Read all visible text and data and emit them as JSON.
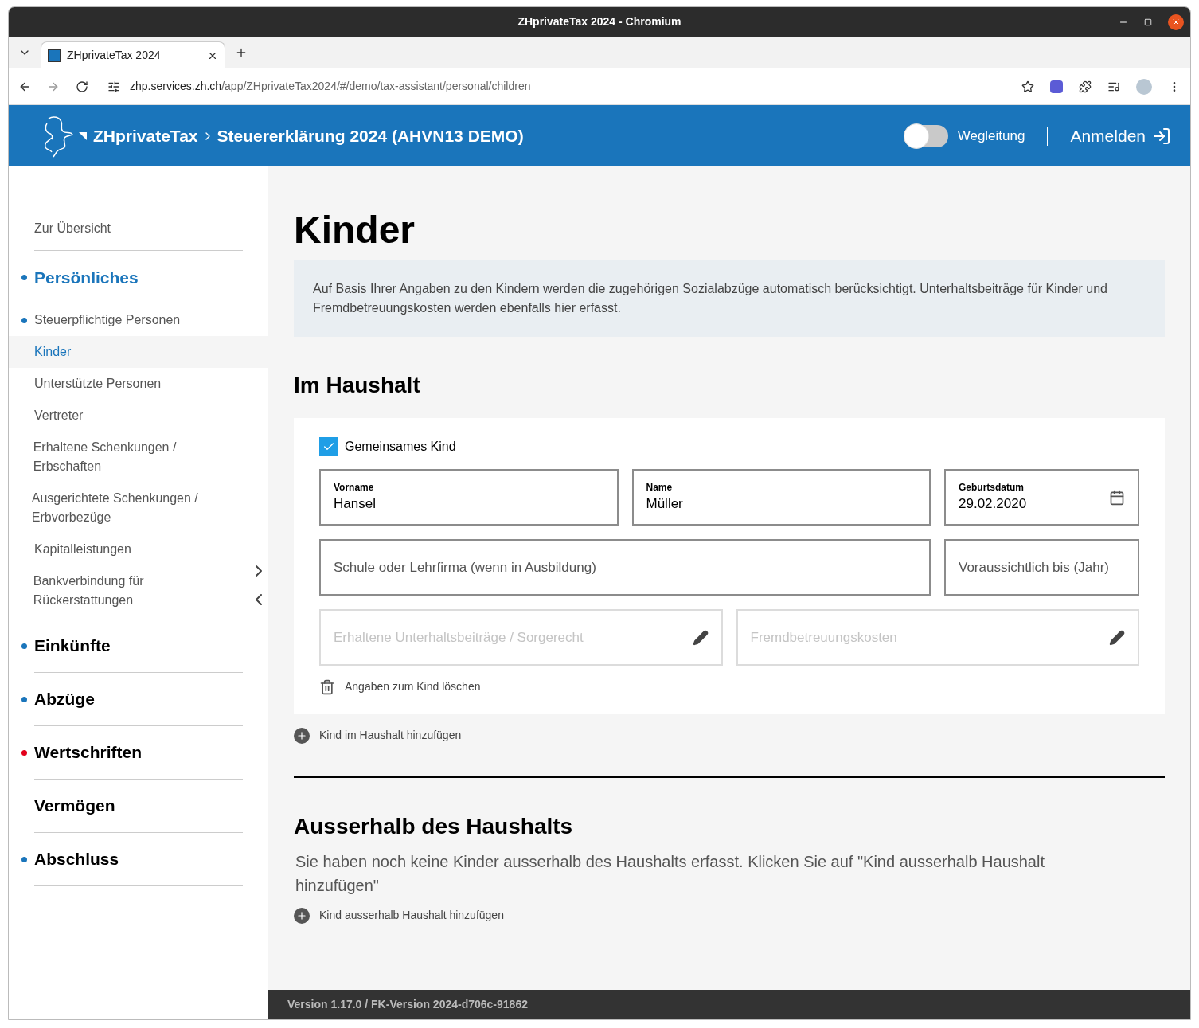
{
  "browser": {
    "window_title": "ZHprivateTax 2024 - Chromium",
    "tab_title": "ZHprivateTax 2024",
    "url_host": "zhp.services.zh.ch",
    "url_path": "/app/ZHprivateTax2024/#/demo/tax-assistant/personal/children"
  },
  "header": {
    "brand": "ZHprivateTax",
    "breadcrumb": "Steuererklärung 2024 (AHVN13 DEMO)",
    "guide_toggle": {
      "label": "Wegleitung",
      "on": false
    },
    "login": "Anmelden"
  },
  "sidebar": {
    "overview": "Zur Übersicht",
    "sections": [
      {
        "label": "Persönliches",
        "color": "#1a75bb",
        "selected": true,
        "expanded": true,
        "items": [
          {
            "label": "Steuerpflichtige Personen",
            "selected": false,
            "done": true
          },
          {
            "label": "Kinder",
            "selected": true,
            "done": false
          },
          {
            "label": "Unterstützte Personen",
            "selected": false,
            "done": false
          },
          {
            "label": "Vertreter",
            "selected": false,
            "done": false
          },
          {
            "label": "Erhaltene Schenkungen / Erbschaften",
            "selected": false,
            "done": false
          },
          {
            "label": "Ausgerichtete Schenkungen / Erbvorbezüge",
            "selected": false,
            "done": false
          },
          {
            "label": "Kapitalleistungen",
            "selected": false,
            "done": false
          },
          {
            "label": "Bankverbindung für Rückerstattungen",
            "selected": false,
            "done": false
          }
        ]
      },
      {
        "label": "Einkünfte",
        "color": "#1a75bb",
        "selected": false,
        "expanded": false
      },
      {
        "label": "Abzüge",
        "color": "#1a75bb",
        "selected": false,
        "expanded": false
      },
      {
        "label": "Wertschriften",
        "color": "#e3001b",
        "selected": false,
        "expanded": false
      },
      {
        "label": "Vermögen",
        "selected": false,
        "expanded": false
      },
      {
        "label": "Abschluss",
        "color": "#1a75bb",
        "selected": false,
        "expanded": false
      }
    ]
  },
  "main": {
    "title": "Kinder",
    "info": "Auf Basis Ihrer Angaben zu den Kindern werden die zugehörigen Sozialabzüge automatisch berücksichtigt. Unterhaltsbeiträge für Kinder und Fremdbetreuungskosten werden ebenfalls hier erfasst.",
    "in_household": {
      "heading": "Im Haushalt",
      "children": [
        {
          "common_child": {
            "label": "Gemeinsames Kind",
            "checked": true
          },
          "rows": [
            {
              "fields": [
                {
                  "kind": "text",
                  "label": "Vorname",
                  "value": "Hansel"
                },
                {
                  "kind": "text",
                  "label": "Name",
                  "value": "Müller"
                },
                {
                  "kind": "date",
                  "label": "Geburtsdatum",
                  "value": "29.02.2020"
                }
              ]
            },
            {
              "fields": [
                {
                  "kind": "text",
                  "placeholder": "Schule oder Lehrfirma (wenn in Ausbildung)"
                },
                {
                  "kind": "text",
                  "placeholder": "Voraussichtlich bis (Jahr)"
                }
              ]
            },
            {
              "fields": [
                {
                  "kind": "edit",
                  "placeholder": "Erhaltene Unterhaltsbeiträge / Sorgerecht"
                },
                {
                  "kind": "edit",
                  "placeholder": "Fremdbetreuungskosten"
                }
              ]
            }
          ],
          "delete": "Angaben zum Kind löschen"
        }
      ],
      "add": "Kind im Haushalt hinzufügen"
    },
    "outside": {
      "heading": "Ausserhalb des Haushalts",
      "message": "Sie haben noch keine Kinder ausserhalb des Haushalts erfasst. Klicken Sie auf \"Kind ausserhalb Haushalt hinzufügen\"",
      "add": "Kind ausserhalb Haushalt hinzufügen"
    }
  },
  "footer": {
    "version": "Version 1.17.0 / FK-Version 2024-d706c-91862"
  }
}
